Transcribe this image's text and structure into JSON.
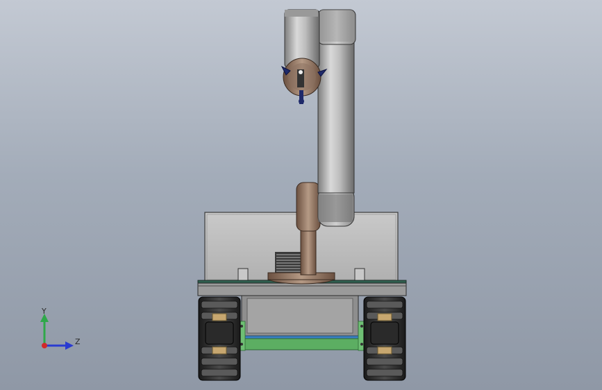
{
  "viewport": {
    "background_top": "#c3c9d3",
    "background_bottom": "#8f98a6"
  },
  "triad": {
    "y_label": "Y",
    "z_label": "Z",
    "y_color": "#2fa84a",
    "z_color": "#2a3bd1",
    "x_color": "#d12a2a"
  },
  "model": {
    "parts": [
      "robot-arm",
      "gripper",
      "enclosure-box",
      "base-platform",
      "wheel-left",
      "wheel-right",
      "chassis",
      "battery-frame"
    ]
  }
}
